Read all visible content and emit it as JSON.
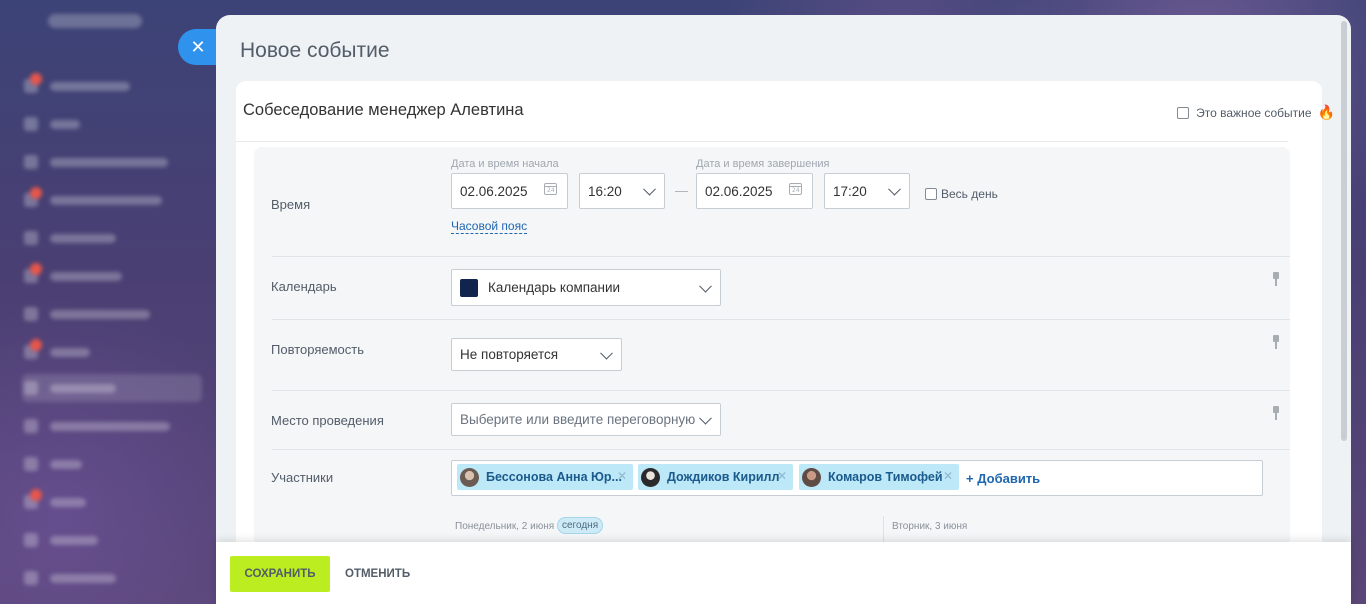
{
  "panel": {
    "title": "Новое событие"
  },
  "event": {
    "name": "Собеседование менеджер Алевтина",
    "important_label": "Это важное событие"
  },
  "time": {
    "label": "Время",
    "start_label": "Дата и время начала",
    "start_date": "02.06.2025",
    "start_time": "16:20",
    "separator": "—",
    "end_label": "Дата и время завершения",
    "end_date": "02.06.2025",
    "end_time": "17:20",
    "all_day_label": "Весь день",
    "timezone_link": "Часовой пояс"
  },
  "calendar": {
    "label": "Календарь",
    "value": "Календарь компании",
    "swatch_color": "#10244d"
  },
  "repeat": {
    "label": "Повторяемость",
    "value": "Не повторяется"
  },
  "location": {
    "label": "Место проведения",
    "placeholder": "Выберите или введите переговорную"
  },
  "members": {
    "label": "Участники",
    "items": [
      {
        "name": "Бессонова Анна Юр..."
      },
      {
        "name": "Дождиков Кирилл"
      },
      {
        "name": "Комаров Тимофей"
      }
    ],
    "add_label": "+ Добавить"
  },
  "planner": {
    "day1": "Понедельник, 2 июня",
    "today_badge": "сегодня",
    "day2": "Вторник, 3 июня"
  },
  "footer": {
    "save_label": "СОХРАНИТЬ",
    "cancel_label": "ОТМЕНИТЬ"
  },
  "colors": {
    "accent": "#2f93ee",
    "save": "#bbed21",
    "chip": "#bde8f8",
    "link": "#2067b0"
  }
}
